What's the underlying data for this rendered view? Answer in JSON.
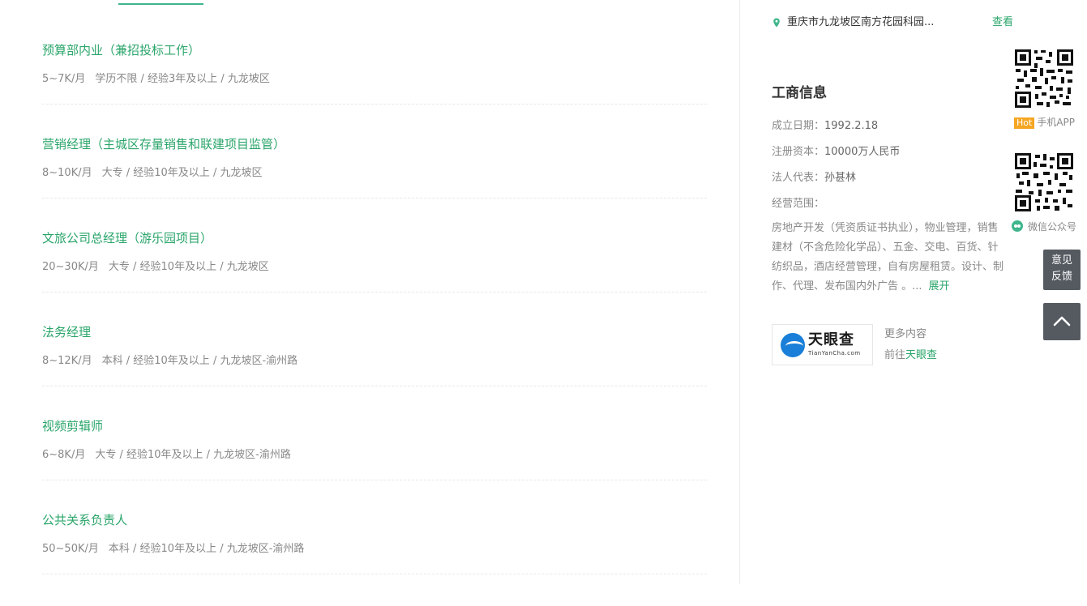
{
  "jobs": [
    {
      "title": "预算部内业（兼招投标工作）",
      "salary": "5~7K/月",
      "details": "学历不限 / 经验3年及以上 / 九龙坡区"
    },
    {
      "title": "营销经理（主城区存量销售和联建项目监管）",
      "salary": "8~10K/月",
      "details": "大专 / 经验10年及以上 / 九龙坡区"
    },
    {
      "title": "文旅公司总经理（游乐园项目）",
      "salary": "20~30K/月",
      "details": "大专 / 经验10年及以上 / 九龙坡区"
    },
    {
      "title": "法务经理",
      "salary": "8~12K/月",
      "details": "本科 / 经验10年及以上 / 九龙坡区-渝州路"
    },
    {
      "title": "视频剪辑师",
      "salary": "6~8K/月",
      "details": "大专 / 经验10年及以上 / 九龙坡区-渝州路"
    },
    {
      "title": "公共关系负责人",
      "salary": "50~50K/月",
      "details": "本科 / 经验10年及以上 / 九龙坡区-渝州路"
    }
  ],
  "address": {
    "text": "重庆市九龙坡区南方花园科园...",
    "view_label": "查看"
  },
  "business": {
    "title": "工商信息",
    "founded_label": "成立日期：",
    "founded": "1992.2.18",
    "capital_label": "注册资本：",
    "capital": "10000万人民币",
    "legal_label": "法人代表：",
    "legal": "孙甚林",
    "scope_label": "经营范围：",
    "scope_text": "房地产开发（凭资质证书执业），物业管理，销售建材（不含危险化学品）、五金、交电、百货、针纺织品，酒店经营管理，自有房屋租赁。设计、制作、代理、发布国内外广告 。...",
    "expand_label": "展开"
  },
  "tianyancha": {
    "logo_cn": "天眼查",
    "logo_en": "TianYanCha.com",
    "more": "更多内容",
    "goto_prefix": "前往",
    "goto_link": "天眼查"
  },
  "qr": {
    "app_hot": "Hot",
    "app_label": "手机APP",
    "wechat_label": "微信公众号"
  },
  "float": {
    "feedback_line1": "意见",
    "feedback_line2": "反馈"
  },
  "colors": {
    "accent": "#2aa56a",
    "float_bg": "#555a61",
    "hot": "#f5a623"
  }
}
